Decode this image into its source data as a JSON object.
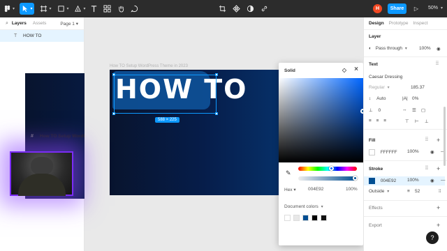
{
  "toolbar": {
    "zoom": "50%",
    "avatar_initial": "H",
    "share_label": "Share"
  },
  "left_panel": {
    "tabs": [
      "Layers",
      "Assets"
    ],
    "page": "Page 1",
    "layers": [
      {
        "label": "How TO  Setup WordPress Theme..."
      },
      {
        "label": "HOW TO"
      }
    ]
  },
  "canvas": {
    "frame_label": "How TO  Setup WordPress Theme in 2023",
    "headline": "HOW TO",
    "size_badge": "588 × 225"
  },
  "picker": {
    "mode": "Solid",
    "format": "Hex",
    "hex": "004E92",
    "opacity": "100%",
    "doc_colors_label": "Document colors",
    "swatches": [
      "#ffffff",
      "#e8e8e8",
      "#004e92",
      "#000000",
      "#111111"
    ]
  },
  "right_panel": {
    "tabs": [
      "Design",
      "Prototype",
      "Inspect"
    ],
    "layer_title": "Layer",
    "blend_mode": "Pass through",
    "layer_opacity": "100%",
    "text_title": "Text",
    "font_family": "Caesar Dressing",
    "font_style": "Regular",
    "font_size": "185.37",
    "line_height": "Auto",
    "letter_spacing": "0%",
    "paragraph_spacing": "0",
    "fill_title": "Fill",
    "fill_hex": "FFFFFF",
    "fill_opacity": "100%",
    "stroke_title": "Stroke",
    "stroke_hex": "004E92",
    "stroke_opacity": "100%",
    "stroke_position": "Outside",
    "stroke_weight": "52",
    "effects_title": "Effects",
    "export_title": "Export"
  },
  "colors": {
    "accent": "#0d99ff",
    "stroke": "#004e92",
    "toolbar_bg": "#2c2c2c"
  }
}
